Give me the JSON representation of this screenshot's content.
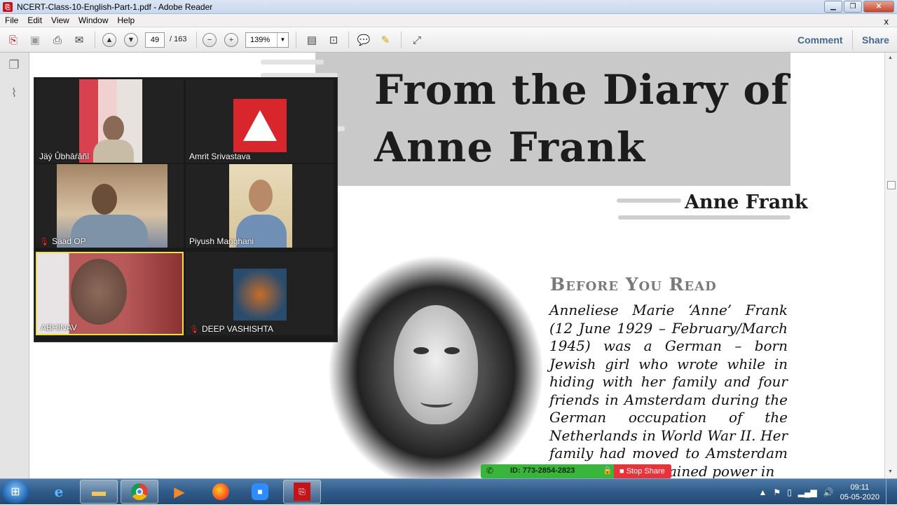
{
  "window": {
    "title": "NCERT-Class-10-English-Part-1.pdf - Adobe Reader",
    "app_icon": "pdf-icon",
    "minimize": "▁",
    "maximize": "❐",
    "close": "✕"
  },
  "menu": {
    "items": [
      "File",
      "Edit",
      "View",
      "Window",
      "Help"
    ],
    "close": "x"
  },
  "toolbar": {
    "page_current": "49",
    "page_total": "/ 163",
    "zoom": "139%",
    "comment": "Comment",
    "share": "Share"
  },
  "document": {
    "title_line1": "From the Diary of",
    "title_line2": "Anne Frank",
    "author": "Anne Frank",
    "heading": "Before You Read",
    "body": "Anneliese Marie ‘Anne’ Frank (12 June 1929 – February/March 1945) was a German – born Jewish girl who wrote while in hiding with her family and four friends in Amsterdam during the German occupation of the Netherlands in World War II. Her family had moved to Amsterdam after the Nazis gained power in"
  },
  "meeting": {
    "participants": [
      {
        "name": "Jäý Ûbhâŕâñî",
        "muted": false,
        "active": false
      },
      {
        "name": "Amrit Srivastava",
        "muted": false,
        "active": false
      },
      {
        "name": "Saad OP",
        "muted": true,
        "active": false
      },
      {
        "name": "Piyush Manghani",
        "muted": false,
        "active": false
      },
      {
        "name": "ABHINAV",
        "muted": false,
        "active": true
      },
      {
        "name": "DEEP VASHISHTA",
        "muted": true,
        "active": false
      }
    ],
    "meeting_id": "ID: 773-2854-2823",
    "stop_share": "Stop Share"
  },
  "taskbar": {
    "apps": [
      "internet-explorer-icon",
      "file-explorer-icon",
      "chrome-icon",
      "media-player-icon",
      "firefox-icon",
      "zoom-icon",
      "adobe-reader-icon"
    ],
    "time": "09:11",
    "date": "05-05-2020"
  },
  "colors": {
    "zoom_green": "#38b53a",
    "stop_red": "#e9333a",
    "active_border": "#f0e04c",
    "link_blue": "#46698e"
  }
}
